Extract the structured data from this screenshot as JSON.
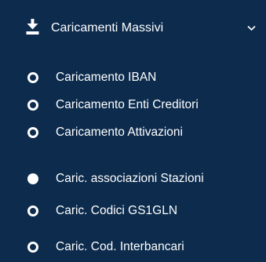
{
  "menu": {
    "header": {
      "label": "Caricamenti Massivi",
      "icon": "download-icon",
      "chevron": "chevron-down-icon"
    },
    "items": [
      {
        "label": "Caricamento IBAN",
        "icon": "radio-circle-icon",
        "selected": false
      },
      {
        "label": "Caricamento Enti Creditori",
        "icon": "radio-circle-icon",
        "selected": false
      },
      {
        "label": "Caricamento Attivazioni",
        "icon": "radio-circle-icon",
        "selected": false
      },
      {
        "label": "Caric. associazioni Stazioni",
        "icon": "radio-circle-filled-icon",
        "selected": true
      },
      {
        "label": "Caric. Codici GS1GLN",
        "icon": "radio-circle-icon",
        "selected": false
      },
      {
        "label": "Caric. Cod. Interbancari",
        "icon": "radio-circle-icon",
        "selected": false
      }
    ]
  },
  "colors": {
    "background": "#0c2b4d",
    "foreground": "#ffffff"
  }
}
